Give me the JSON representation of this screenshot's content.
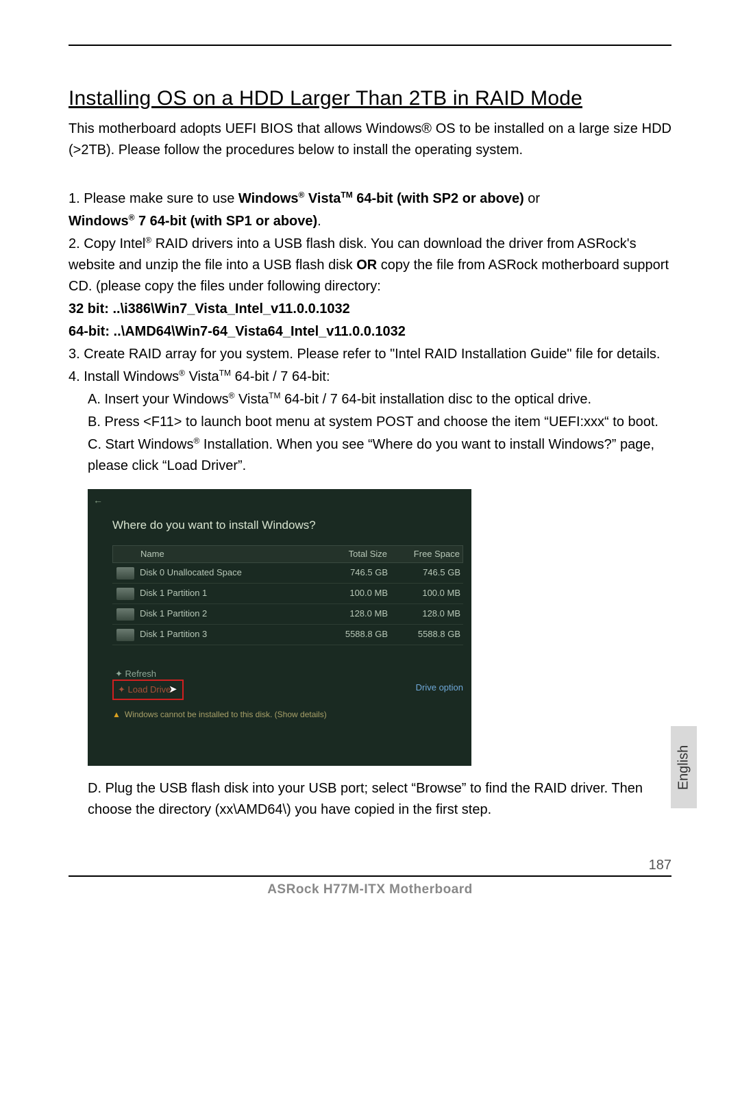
{
  "title": "Installing OS on a HDD Larger Than 2TB in RAID Mode",
  "intro": "This motherboard adopts UEFI BIOS that allows Windows® OS to be installed on a large size HDD (>2TB). Please follow the procedures below to install the operating system.",
  "step1_a": "1. Please make sure to use ",
  "step1_b": "Windows",
  "step1_c": " Vista",
  "step1_d": " 64-bit (with SP2 or above)",
  "step1_e": " or",
  "step1_f": "Windows",
  "step1_g": " 7 64-bit (with SP1 or above)",
  "step1_h": ".",
  "step2_a": "2. Copy Intel",
  "step2_b": " RAID drivers into a USB flash disk. You can download the driver from ASRock's website and unzip the file into a USB flash disk ",
  "step2_or": "OR",
  "step2_c": " copy the file from ASRock motherboard support CD. (please copy the files under following directory:",
  "step2_path32": "32 bit: ..\\i386\\Win7_Vista_Intel_v11.0.0.1032",
  "step2_path64": "64-bit: ..\\AMD64\\Win7-64_Vista64_Intel_v11.0.0.1032",
  "step3": "3. Create RAID array for you system. Please refer to \"Intel RAID Installation Guide\" file for details.",
  "step4_a": "4. Install Windows",
  "step4_b": " Vista",
  "step4_c": " 64-bit / 7 64-bit:",
  "step4A_a": "A. Insert your Windows",
  "step4A_b": " Vista",
  "step4A_c": " 64-bit / 7 64-bit installation disc to the optical drive.",
  "step4B": "B. Press <F11> to launch boot menu at system POST and choose the item “UEFI:xxx“ to boot.",
  "step4C_a": "C. Start Windows",
  "step4C_b": " Installation. When you see “Where do you want to install Windows?” page, please click “Load Driver”.",
  "step4D": "D. Plug the USB flash disk into your USB port; select “Browse” to find the RAID driver. Then choose the directory (xx\\AMD64\\) you have copied in the first step.",
  "fig": {
    "heading": "Where do you want to install Windows?",
    "col_name": "Name",
    "col_ts": "Total Size",
    "col_fs": "Free Space",
    "rows": [
      {
        "name": "Disk 0 Unallocated Space",
        "ts": "746.5 GB",
        "fs": "746.5 GB"
      },
      {
        "name": "Disk 1 Partition 1",
        "ts": "100.0 MB",
        "fs": "100.0 MB"
      },
      {
        "name": "Disk 1 Partition 2",
        "ts": "128.0 MB",
        "fs": "128.0 MB"
      },
      {
        "name": "Disk 1 Partition 3",
        "ts": "5588.8 GB",
        "fs": "5588.8 GB"
      }
    ],
    "refresh": "Refresh",
    "load": "Load Driver",
    "driveopt": "Drive option",
    "warn": "Windows cannot be installed to this disk. (Show details)"
  },
  "lang": "English",
  "page_num": "187",
  "footer_model": "ASRock  H77M-ITX  Motherboard"
}
